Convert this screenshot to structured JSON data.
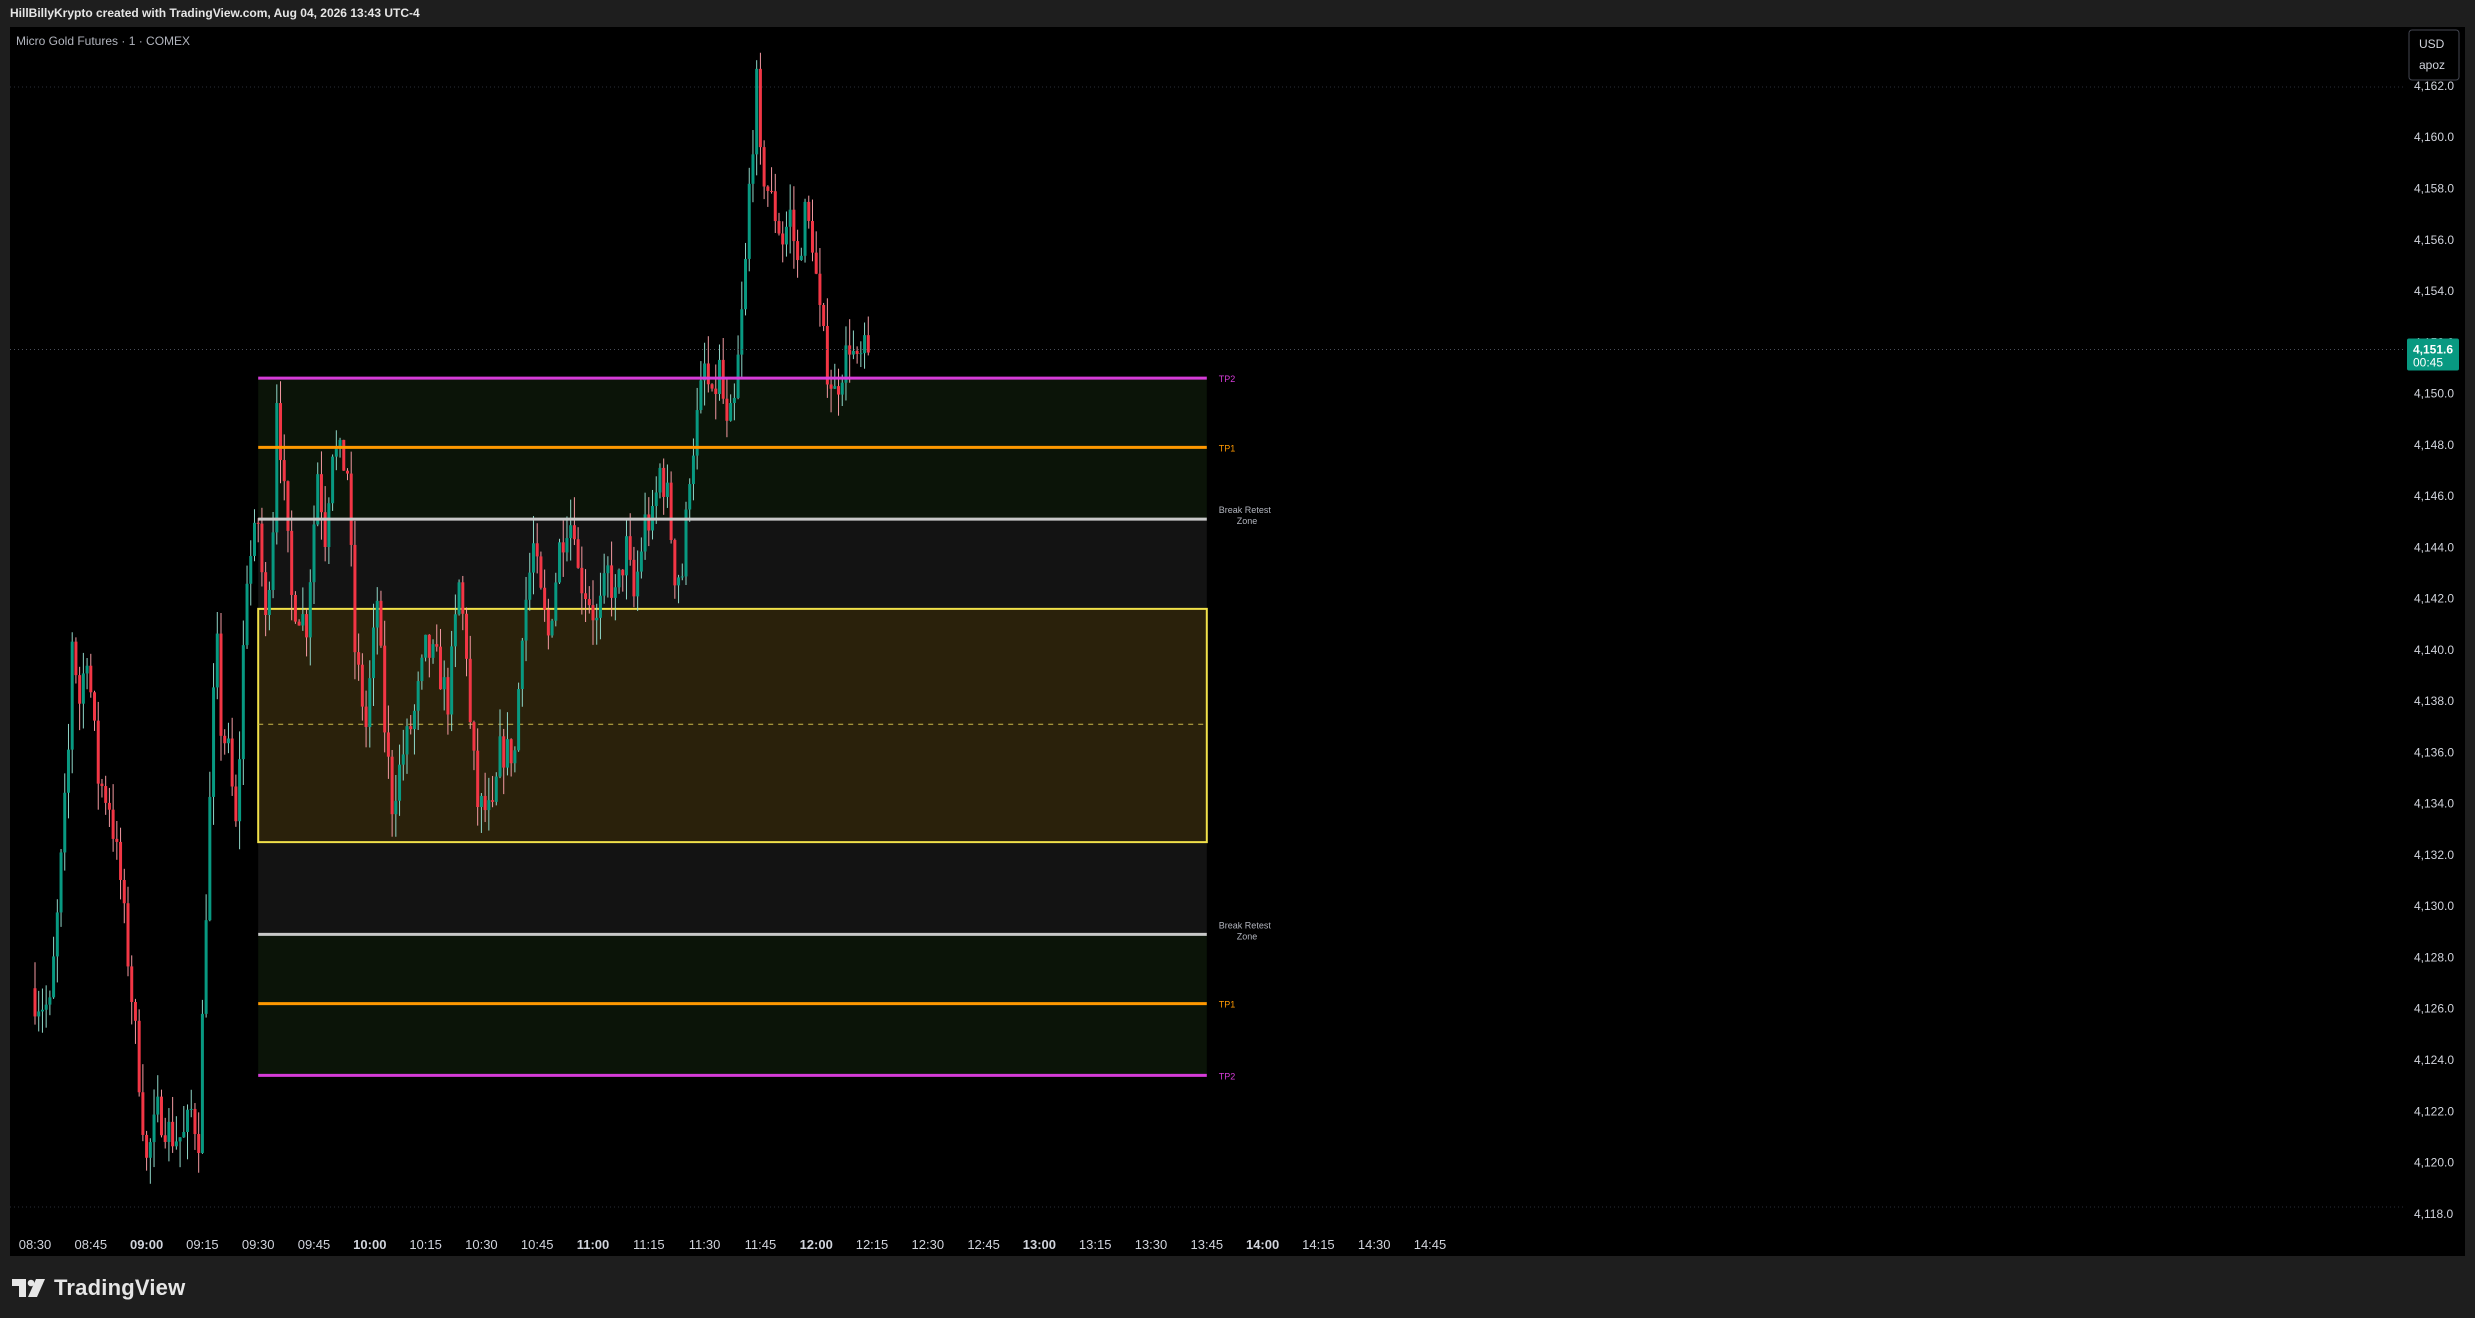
{
  "header": {
    "text": "HillBillyKrypto created with TradingView.com, Aug 04, 2026 13:43 UTC-4"
  },
  "symbol": {
    "title": "Micro Gold Futures · 1 · COMEX"
  },
  "currency_box": {
    "currency": "USD",
    "unit": "apoz"
  },
  "current_price": {
    "value": "4,151.6",
    "countdown": "00:45",
    "color": "#089981"
  },
  "footer": {
    "logo_text": "TradingView"
  },
  "colors": {
    "up": "#089981",
    "down": "#f23645",
    "tp2": "#d63cd8",
    "tp1": "#ff9800",
    "zone_line": "#c8c8c8",
    "box": "#f1e14a"
  },
  "chart_data": {
    "type": "candlestick",
    "title": "Micro Gold Futures · 1 · COMEX",
    "ylim": [
      4116.9,
      4164.3
    ],
    "y_ticks": [
      4118,
      4120,
      4122,
      4124,
      4126,
      4128,
      4130,
      4132,
      4134,
      4136,
      4138,
      4140,
      4142,
      4144,
      4146,
      4148,
      4150,
      4152,
      4154,
      4156,
      4158,
      4160,
      4162
    ],
    "x_ticks": [
      {
        "label": "08:30",
        "min": 0,
        "bold": false
      },
      {
        "label": "08:45",
        "min": 15,
        "bold": false
      },
      {
        "label": "09:00",
        "min": 30,
        "bold": true
      },
      {
        "label": "09:15",
        "min": 45,
        "bold": false
      },
      {
        "label": "09:30",
        "min": 60,
        "bold": false
      },
      {
        "label": "09:45",
        "min": 75,
        "bold": false
      },
      {
        "label": "10:00",
        "min": 90,
        "bold": true
      },
      {
        "label": "10:15",
        "min": 105,
        "bold": false
      },
      {
        "label": "10:30",
        "min": 120,
        "bold": false
      },
      {
        "label": "10:45",
        "min": 135,
        "bold": false
      },
      {
        "label": "11:00",
        "min": 150,
        "bold": true
      },
      {
        "label": "11:15",
        "min": 165,
        "bold": false
      },
      {
        "label": "11:30",
        "min": 180,
        "bold": false
      },
      {
        "label": "11:45",
        "min": 195,
        "bold": false
      },
      {
        "label": "12:00",
        "min": 210,
        "bold": true
      },
      {
        "label": "12:15",
        "min": 225,
        "bold": false
      },
      {
        "label": "12:30",
        "min": 240,
        "bold": false
      },
      {
        "label": "12:45",
        "min": 255,
        "bold": false
      },
      {
        "label": "13:00",
        "min": 270,
        "bold": true
      },
      {
        "label": "13:15",
        "min": 285,
        "bold": false
      },
      {
        "label": "13:30",
        "min": 300,
        "bold": false
      },
      {
        "label": "13:45",
        "min": 315,
        "bold": false
      },
      {
        "label": "14:00",
        "min": 330,
        "bold": true
      },
      {
        "label": "14:15",
        "min": 345,
        "bold": false
      },
      {
        "label": "14:30",
        "min": 360,
        "bold": false
      },
      {
        "label": "14:45",
        "min": 375,
        "bold": false
      }
    ],
    "x_start_label": "08:30",
    "price_anchors": [
      [
        0,
        4126.5
      ],
      [
        5,
        4126
      ],
      [
        7,
        4129.5
      ],
      [
        10,
        4136
      ],
      [
        11,
        4140.5
      ],
      [
        13,
        4138
      ],
      [
        15,
        4140
      ],
      [
        18,
        4135
      ],
      [
        21,
        4134
      ],
      [
        24,
        4131
      ],
      [
        28,
        4125
      ],
      [
        31,
        4120
      ],
      [
        34,
        4122
      ],
      [
        38,
        4121
      ],
      [
        41,
        4121
      ],
      [
        43,
        4122
      ],
      [
        45,
        4121
      ],
      [
        47,
        4130
      ],
      [
        49,
        4138
      ],
      [
        50,
        4140
      ],
      [
        51,
        4137
      ],
      [
        53,
        4136
      ],
      [
        54,
        4134.5
      ],
      [
        55,
        4133
      ],
      [
        56,
        4136
      ],
      [
        57,
        4140
      ],
      [
        58,
        4143
      ],
      [
        61,
        4145
      ],
      [
        63,
        4141
      ],
      [
        65,
        4145
      ],
      [
        66,
        4150
      ],
      [
        68,
        4146
      ],
      [
        70,
        4142
      ],
      [
        74,
        4141
      ],
      [
        77,
        4147
      ],
      [
        79,
        4144.5
      ],
      [
        81,
        4148
      ],
      [
        85,
        4147
      ],
      [
        87,
        4140
      ],
      [
        90,
        4137
      ],
      [
        93,
        4142
      ],
      [
        95,
        4137
      ],
      [
        97,
        4134
      ],
      [
        100,
        4136
      ],
      [
        103,
        4137.5
      ],
      [
        106,
        4140
      ],
      [
        109,
        4139.5
      ],
      [
        112,
        4138
      ],
      [
        115,
        4142.5
      ],
      [
        117,
        4140
      ],
      [
        118,
        4137
      ],
      [
        120,
        4134
      ],
      [
        124,
        4133.5
      ],
      [
        126,
        4136
      ],
      [
        130,
        4136
      ],
      [
        132,
        4141
      ],
      [
        135,
        4144
      ],
      [
        137,
        4142
      ],
      [
        139,
        4140.5
      ],
      [
        142,
        4144
      ],
      [
        144,
        4145
      ],
      [
        146,
        4145
      ],
      [
        147,
        4143
      ],
      [
        150,
        4142
      ],
      [
        152,
        4141
      ],
      [
        155,
        4143
      ],
      [
        157,
        4142
      ],
      [
        160,
        4144
      ],
      [
        162,
        4142
      ],
      [
        165,
        4145
      ],
      [
        167,
        4145
      ],
      [
        169,
        4147
      ],
      [
        171,
        4146
      ],
      [
        173,
        4143
      ],
      [
        175,
        4143
      ],
      [
        177,
        4147
      ],
      [
        179,
        4149
      ],
      [
        181,
        4151
      ],
      [
        183,
        4149.5
      ],
      [
        185,
        4151
      ],
      [
        187,
        4148.5
      ],
      [
        189,
        4149.5
      ],
      [
        191,
        4153
      ],
      [
        192,
        4155
      ],
      [
        193,
        4158
      ],
      [
        194,
        4160
      ],
      [
        195,
        4162
      ],
      [
        196,
        4159
      ],
      [
        198,
        4158
      ],
      [
        200,
        4157
      ],
      [
        202,
        4156
      ],
      [
        204,
        4157
      ],
      [
        206,
        4155
      ],
      [
        208,
        4157
      ],
      [
        210,
        4156
      ],
      [
        212,
        4153
      ],
      [
        214,
        4151
      ],
      [
        216,
        4150
      ],
      [
        218,
        4151
      ],
      [
        220,
        4152
      ],
      [
        222,
        4151
      ],
      [
        224,
        4151.6
      ]
    ],
    "levels": [
      {
        "name": "tp2_upper",
        "price": 4150.6,
        "label": "TP2",
        "color": "#d63cd8"
      },
      {
        "name": "tp1_upper",
        "price": 4147.9,
        "label": "TP1",
        "color": "#ff9800"
      },
      {
        "name": "zone_upper",
        "price": 4145.1,
        "label": "Break Retest\nZone",
        "color": "#c8c8c8"
      },
      {
        "name": "zone_lower",
        "price": 4128.9,
        "label": "Break Retest\nZone",
        "color": "#c8c8c8"
      },
      {
        "name": "tp1_lower",
        "price": 4126.2,
        "label": "TP1",
        "color": "#ff9800"
      },
      {
        "name": "tp2_lower",
        "price": 4123.4,
        "label": "TP2",
        "color": "#d63cd8"
      }
    ],
    "range_box": {
      "top": 4141.6,
      "bottom": 4132.5,
      "mid": 4137.1,
      "start_min": 60,
      "end_min": 315
    },
    "current_price": 4151.6
  }
}
